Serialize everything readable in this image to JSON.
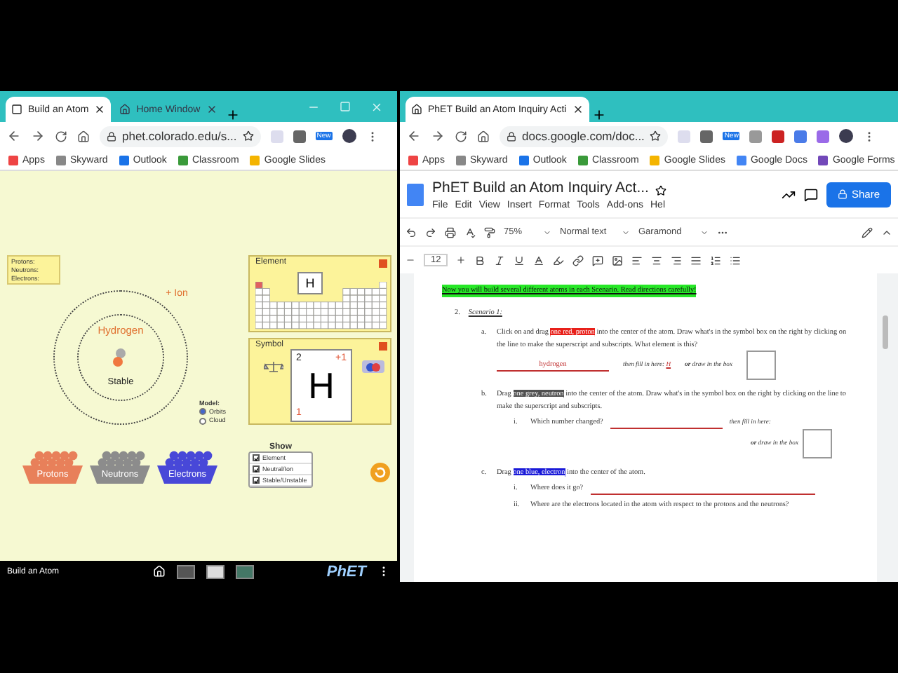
{
  "left_window": {
    "tabs": [
      {
        "label": "Build an Atom",
        "selected": true
      },
      {
        "label": "Home Window",
        "selected": false
      }
    ],
    "address": "phet.colorado.edu/s...",
    "new_badge": "New",
    "bookmarks": [
      "Apps",
      "Skyward",
      "Outlook",
      "Classroom",
      "Google Slides"
    ],
    "sim": {
      "counts": [
        "Protons:",
        "Neutrons:",
        "Electrons:"
      ],
      "ion_label": "+ Ion",
      "element_name": "Hydrogen",
      "stability": "Stable",
      "element_panel": {
        "title": "Element",
        "symbol": "H"
      },
      "symbol_panel": {
        "title": "Symbol",
        "mass_number": "2",
        "charge": "+1",
        "atomic_number": "1",
        "symbol": "H"
      },
      "model": {
        "title": "Model:",
        "options": [
          {
            "label": "Orbits",
            "selected": true
          },
          {
            "label": "Cloud",
            "selected": false
          }
        ]
      },
      "show": {
        "title": "Show",
        "options": [
          {
            "label": "Element",
            "checked": true
          },
          {
            "label": "Neutral/Ion",
            "checked": true
          },
          {
            "label": "Stable/Unstable",
            "checked": true
          }
        ]
      },
      "buckets": [
        {
          "label": "Protons",
          "color": "#e8805a"
        },
        {
          "label": "Neutrons",
          "color": "#8c8c8c"
        },
        {
          "label": "Electrons",
          "color": "#4848d8"
        }
      ]
    },
    "navbar": {
      "title": "Build an Atom",
      "logo": "PhET"
    }
  },
  "right_window": {
    "tab": {
      "label": "PhET Build an Atom Inquiry Acti",
      "selected": true
    },
    "address": "docs.google.com/doc...",
    "new_badge": "New",
    "bookmarks": [
      "Apps",
      "Skyward",
      "Outlook",
      "Classroom",
      "Google Slides",
      "Google Docs",
      "Google Forms"
    ],
    "doc_title": "PhET Build an Atom Inquiry Act...",
    "menus": [
      "File",
      "Edit",
      "View",
      "Insert",
      "Format",
      "Tools",
      "Add-ons",
      "Hel"
    ],
    "share": "Share",
    "zoom": "75%",
    "style": "Normal text",
    "font": "Garamond",
    "font_size": "12",
    "document": {
      "banner": "Now you will build several different atoms in each Scenario. Read directions carefully!",
      "section": {
        "number": "2.",
        "title": "Scenario 1:"
      },
      "items": [
        {
          "marker": "a.",
          "before": "Click on and drag ",
          "highlight": "one red, proton",
          "color": "#e8201a",
          "after": " into the center of the atom.  Draw what's in the symbol box on the right by clicking on the line to make the superscript and subscripts.  What element is this?",
          "answer": "hydrogen",
          "fill_label": "then fill in here:",
          "fill_symbol": "H",
          "box_label": "**or** draw in the box"
        },
        {
          "marker": "b.",
          "before": "Drag ",
          "highlight": "one grey, neutron",
          "color": "#505050",
          "after": " into the center of the atom.  Draw what's in the symbol box on the right by clicking on the line to make the superscript and subscripts.",
          "subitems": [
            {
              "marker": "i.",
              "text": "Which number changed?",
              "answer_line": true,
              "fill_label": "then fill in here:"
            }
          ],
          "box_label": "**or** draw in the box"
        },
        {
          "marker": "c.",
          "before": "Drag ",
          "highlight": "one blue, electron",
          "color": "#1a1ad8",
          "after": " into the center of the atom.",
          "subitems": [
            {
              "marker": "i.",
              "text": "Where does it go?",
              "answer_line": true
            },
            {
              "marker": "ii.",
              "text": "Where are the electrons located in the atom with respect to the protons and the neutrons?",
              "answer_line": false
            }
          ]
        }
      ]
    }
  }
}
